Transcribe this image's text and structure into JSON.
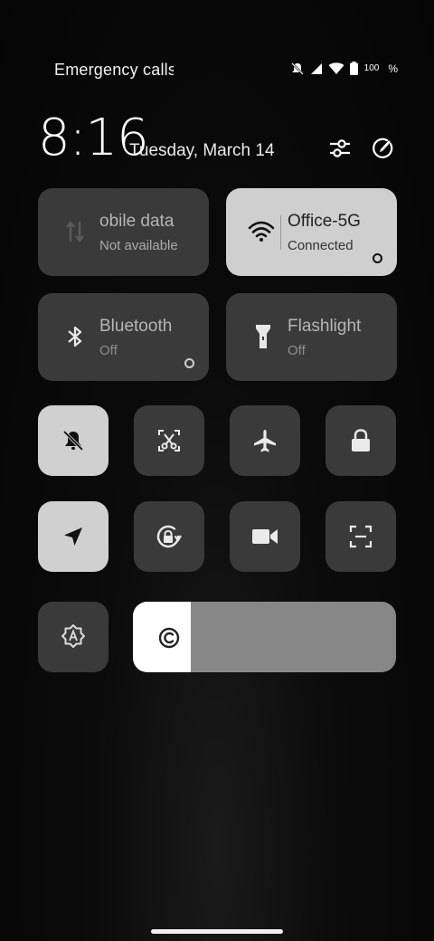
{
  "status_bar": {
    "carrier_text": "Emergency calls",
    "battery_level_text": "100",
    "battery_percent_sign": "%"
  },
  "header": {
    "time": "8:16",
    "date": "Tuesday, March 14",
    "settings_icon": "sliders-icon",
    "edit_icon": "edit-pencil-icon"
  },
  "large_tiles": [
    {
      "label": "obile data",
      "sub": "Not available",
      "icon": "mobile-data-icon",
      "active": false
    },
    {
      "label": "Office-5G",
      "sub": "Connected",
      "icon": "wifi-icon",
      "active": true
    },
    {
      "label": "Bluetooth",
      "sub": "Off",
      "icon": "bluetooth-icon",
      "active": false
    },
    {
      "label": "Flashlight",
      "sub": "Off",
      "icon": "flashlight-icon",
      "active": false
    }
  ],
  "small_tiles": [
    {
      "icon": "bell-off-icon",
      "active": true
    },
    {
      "icon": "screenshot-crop-icon",
      "active": false
    },
    {
      "icon": "airplane-icon",
      "active": false
    },
    {
      "icon": "lock-icon",
      "active": false
    },
    {
      "icon": "location-arrow-icon",
      "active": true
    },
    {
      "icon": "auto-rotate-icon",
      "active": false
    },
    {
      "icon": "video-camera-icon",
      "active": false
    },
    {
      "icon": "scan-frame-icon",
      "active": false
    },
    {
      "icon": "auto-brightness-icon",
      "active": false
    }
  ],
  "brightness": {
    "level_fraction": 0.22,
    "icon": "brightness-icon"
  },
  "colors": {
    "tile_inactive": "#3a3a3a",
    "tile_active": "#cfcfcf",
    "slider_track": "#878787",
    "slider_fill": "#ffffff"
  }
}
